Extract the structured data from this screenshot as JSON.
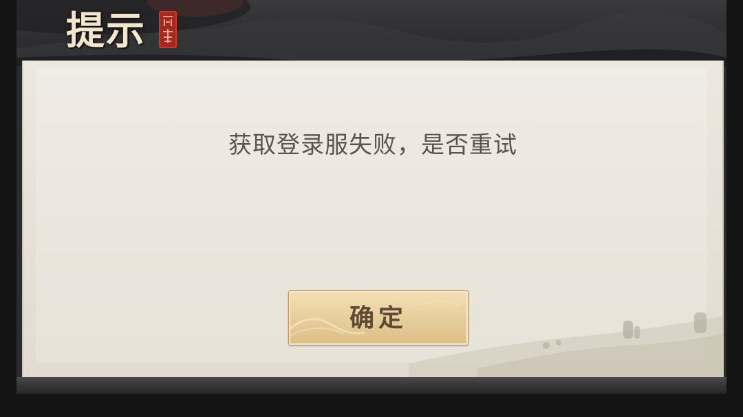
{
  "dialog": {
    "title": "提示",
    "message": "获取登录服失败，是否重试",
    "confirm_label": "确定"
  },
  "icons": {
    "seal": "red-seal-stamp-icon"
  },
  "colors": {
    "title_text": "#f3e6cf",
    "message_text": "#5b534d",
    "button_text": "#5c4a32",
    "paper": "#e7e2d7",
    "header": "#2f2f31",
    "seal": "#a5281f",
    "button_gold": "#e8cd9c"
  }
}
